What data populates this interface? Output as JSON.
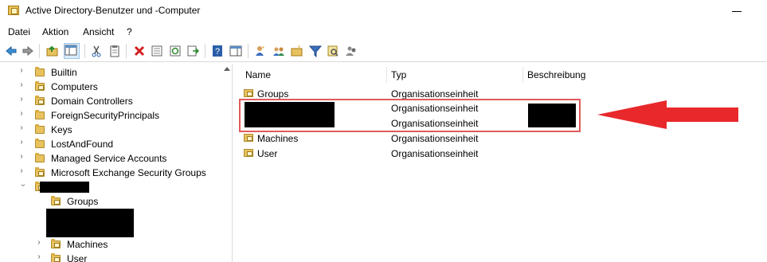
{
  "window": {
    "title": "Active Directory-Benutzer und -Computer"
  },
  "menu": {
    "items": [
      "Datei",
      "Aktion",
      "Ansicht",
      "?"
    ]
  },
  "tree": {
    "items": [
      {
        "label": "Builtin"
      },
      {
        "label": "Computers"
      },
      {
        "label": "Domain Controllers"
      },
      {
        "label": "ForeignSecurityPrincipals"
      },
      {
        "label": "Keys"
      },
      {
        "label": "LostAndFound"
      },
      {
        "label": "Managed Service Accounts"
      },
      {
        "label": "Microsoft Exchange Security Groups"
      }
    ],
    "children": [
      {
        "label": "Groups"
      },
      {
        "label": "Machines"
      },
      {
        "label": "User"
      }
    ]
  },
  "list": {
    "columns": [
      "Name",
      "Typ",
      "Beschreibung"
    ],
    "rows": [
      {
        "name": "Groups",
        "type": "Organisationseinheit"
      },
      {
        "name": "",
        "type": "Organisationseinheit"
      },
      {
        "name": "",
        "type": "Organisationseinheit"
      },
      {
        "name": "Machines",
        "type": "Organisationseinheit"
      },
      {
        "name": "User",
        "type": "Organisationseinheit"
      }
    ]
  },
  "colors": {
    "annotation_red": "#e8282b",
    "folder": "#e8c25f"
  }
}
